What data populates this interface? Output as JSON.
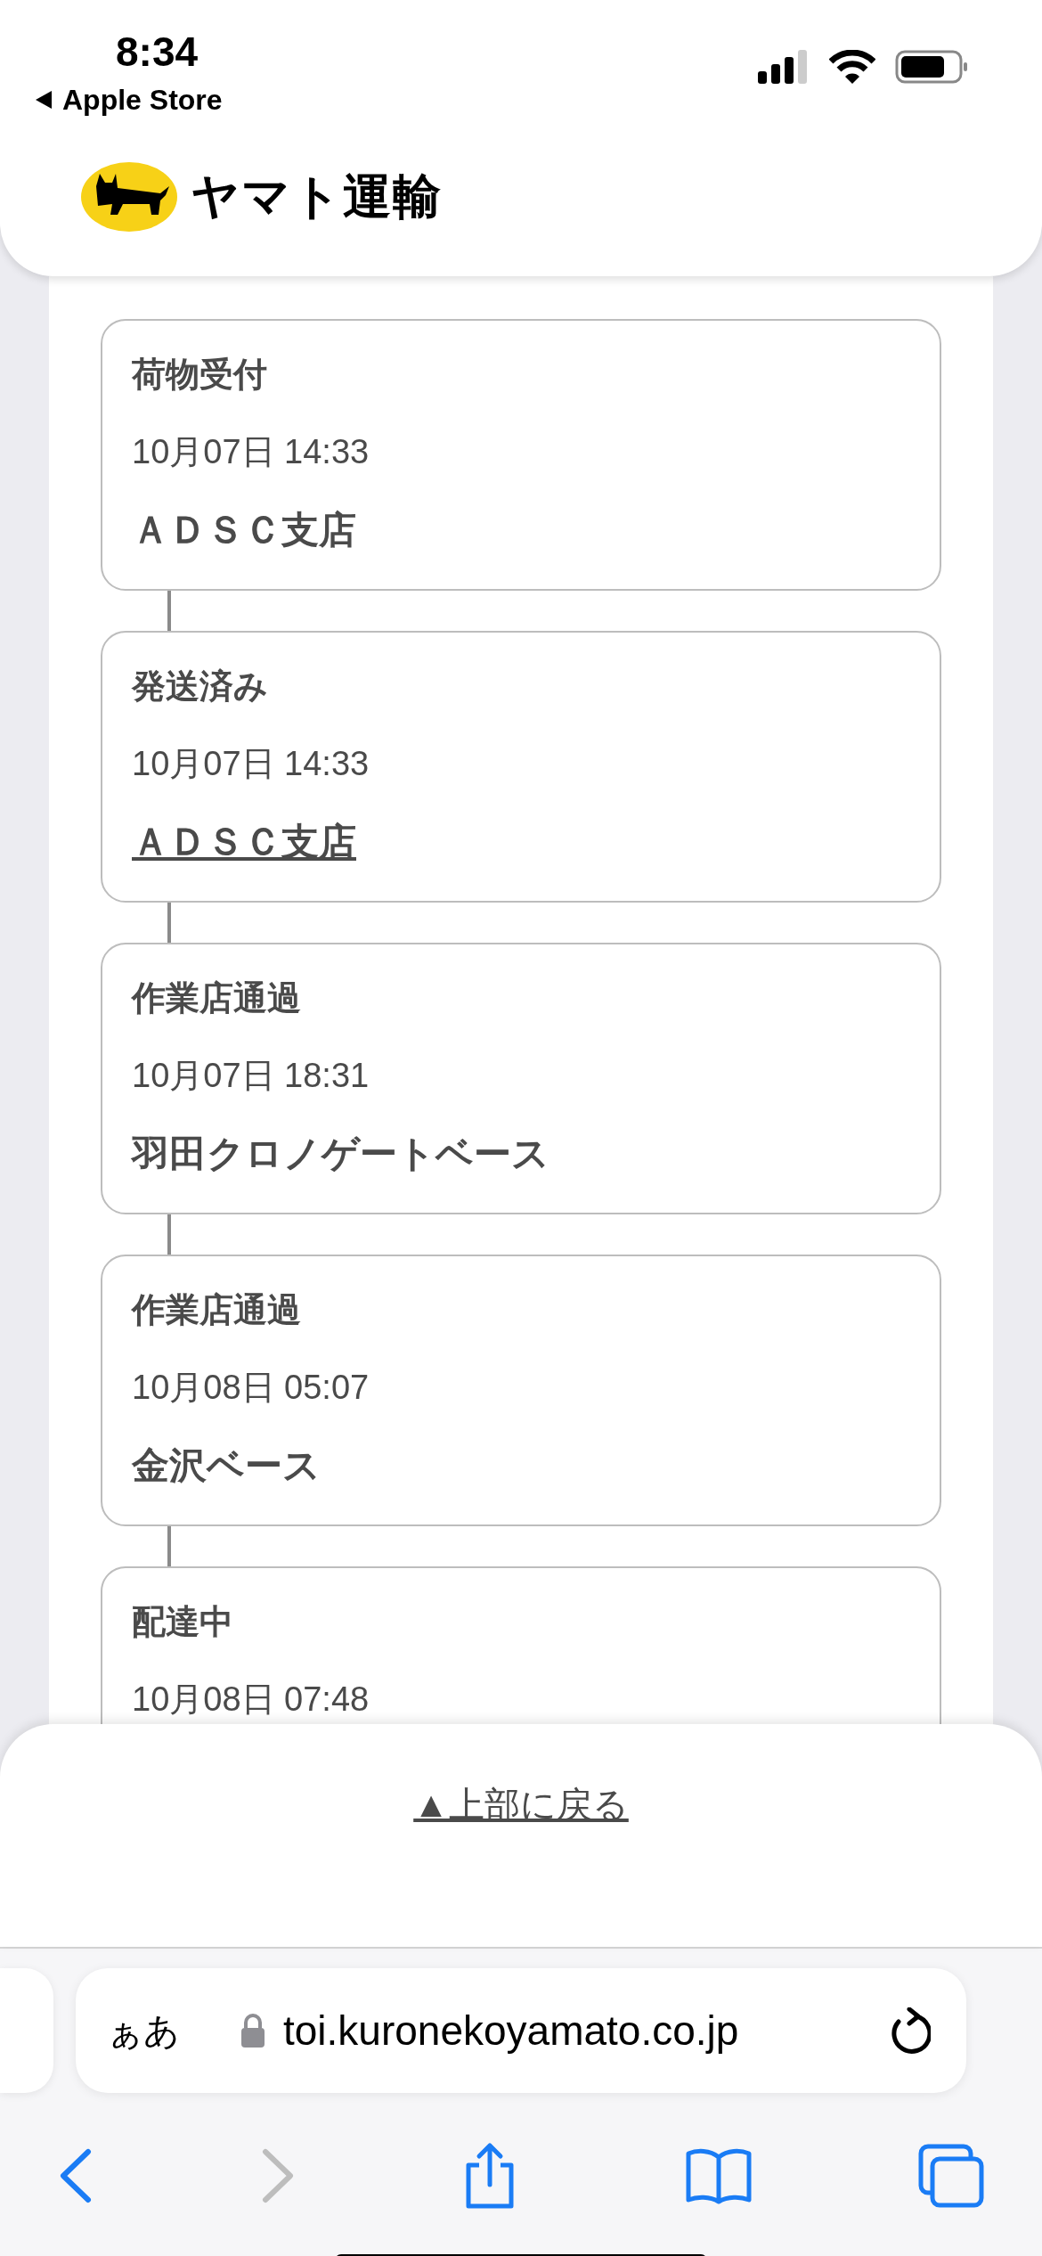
{
  "status_bar": {
    "time": "8:34",
    "back_app": "Apple Store"
  },
  "header": {
    "logo_text": "ヤマト運輸"
  },
  "tracking": [
    {
      "status": "荷物受付",
      "datetime": "10月07日 14:33",
      "location": "ＡＤＳＣ支店",
      "link": false
    },
    {
      "status": "発送済み",
      "datetime": "10月07日 14:33",
      "location": "ＡＤＳＣ支店",
      "link": true
    },
    {
      "status": "作業店通過",
      "datetime": "10月07日 18:31",
      "location": "羽田クロノゲートベース",
      "link": false
    },
    {
      "status": "作業店通過",
      "datetime": "10月08日 05:07",
      "location": "金沢ベース",
      "link": false
    },
    {
      "status": "配達中",
      "datetime": "10月08日 07:48"
    }
  ],
  "back_to_top": "▲上部に戻る",
  "browser": {
    "text_size": "ぁあ",
    "url": "toi.kuronekoyamato.co.jp"
  }
}
